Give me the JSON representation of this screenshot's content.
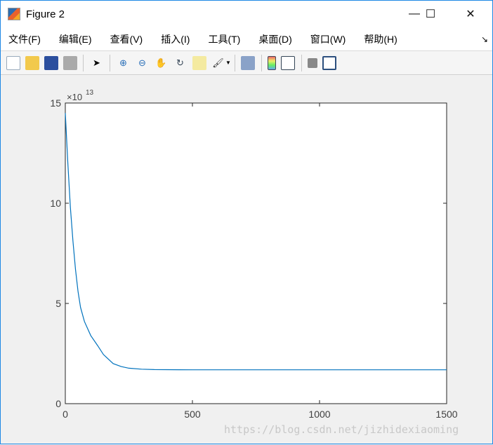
{
  "window": {
    "title": "Figure 2",
    "minimize": "—",
    "maximize": "☐",
    "close": "✕"
  },
  "menu": [
    "文件(F)",
    "编辑(E)",
    "查看(V)",
    "插入(I)",
    "工具(T)",
    "桌面(D)",
    "窗口(W)",
    "帮助(H)"
  ],
  "menu_arrow": "↘",
  "toolbar": [
    "new-figure",
    "open-file",
    "save",
    "print",
    "edit-plot-pointer",
    "zoom-in",
    "zoom-out",
    "pan",
    "rotate-3d",
    "data-cursor",
    "brush",
    "brush-dropdown",
    "link-plot",
    "insert-colorbar",
    "insert-legend",
    "hide-plot-tools",
    "show-plot-tools"
  ],
  "watermark": "https://blog.csdn.net/jizhidexiaoming",
  "chart_data": {
    "type": "line",
    "title": "",
    "xlabel": "",
    "ylabel": "",
    "xlim": [
      0,
      1500
    ],
    "ylim": [
      0,
      15
    ],
    "y_exponent_label": "×10",
    "y_exponent": "13",
    "xticks": [
      0,
      500,
      1000,
      1500
    ],
    "yticks": [
      0,
      5,
      10,
      15
    ],
    "grid": false,
    "series": [
      {
        "name": "",
        "color": "#0072bd",
        "x": [
          0,
          10,
          20,
          30,
          40,
          50,
          60,
          75,
          100,
          127,
          150,
          188,
          220,
          250,
          300,
          350,
          500,
          1000,
          1500
        ],
        "y": [
          14.5,
          12.0,
          9.8,
          8.1,
          6.7,
          5.6,
          4.8,
          4.1,
          3.4,
          2.9,
          2.45,
          2.0,
          1.85,
          1.77,
          1.72,
          1.7,
          1.69,
          1.69,
          1.69
        ]
      }
    ]
  }
}
